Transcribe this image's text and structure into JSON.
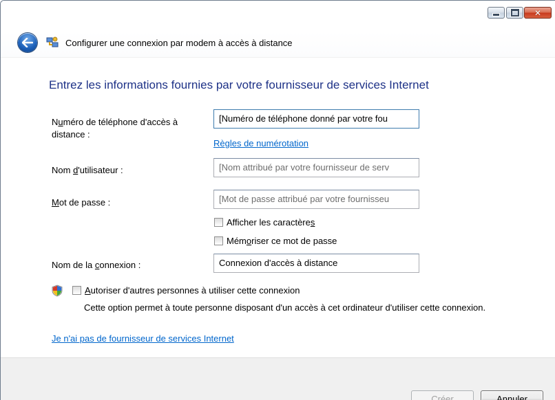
{
  "window": {
    "title": "Configurer une connexion par modem à accès à distance",
    "caption_buttons": {
      "minimize": "minimize-icon",
      "maximize": "maximize-icon",
      "close": "close-icon"
    }
  },
  "page": {
    "heading": "Entrez les informations fournies par votre fournisseur de services Internet"
  },
  "form": {
    "phone": {
      "label_line1_pre": "N",
      "label_line1_u": "u",
      "label_line1_post": "méro de téléphone d'accès à",
      "label_line2": "distance :",
      "value": "[Numéro de téléphone donné par votre fou"
    },
    "dialing_rules_link": "Règles de numérotation",
    "username": {
      "label_pre": "Nom ",
      "label_u": "d",
      "label_post": "'utilisateur :",
      "value": "[Nom attribué par votre fournisseur de serv"
    },
    "password": {
      "label_u": "M",
      "label_post": "ot de passe :",
      "value": "[Mot de passe attribué par votre fournisseu"
    },
    "show_chars": {
      "pre": "Afficher les caractère",
      "u": "s",
      "post": ""
    },
    "remember_password": {
      "pre": "Mém",
      "u": "o",
      "post": "riser ce mot de passe"
    },
    "connection_name": {
      "label_pre": "Nom de la ",
      "label_u": "c",
      "label_post": "onnexion :",
      "value": "Connexion d'accès à distance"
    },
    "allow_others": {
      "u": "A",
      "post": "utoriser d'autres personnes à utiliser cette connexion"
    },
    "allow_others_desc": "Cette option permet à toute personne disposant d'un accès à cet ordinateur d'utiliser cette connexion.",
    "no_isp_link": "Je n'ai pas de fournisseur de services Internet"
  },
  "footer": {
    "create": {
      "u": "C",
      "post": "réer"
    },
    "cancel": "Annuler"
  },
  "colors": {
    "heading": "#1e3287",
    "link": "#0066cc",
    "footer_bg": "#f0f0f0"
  }
}
